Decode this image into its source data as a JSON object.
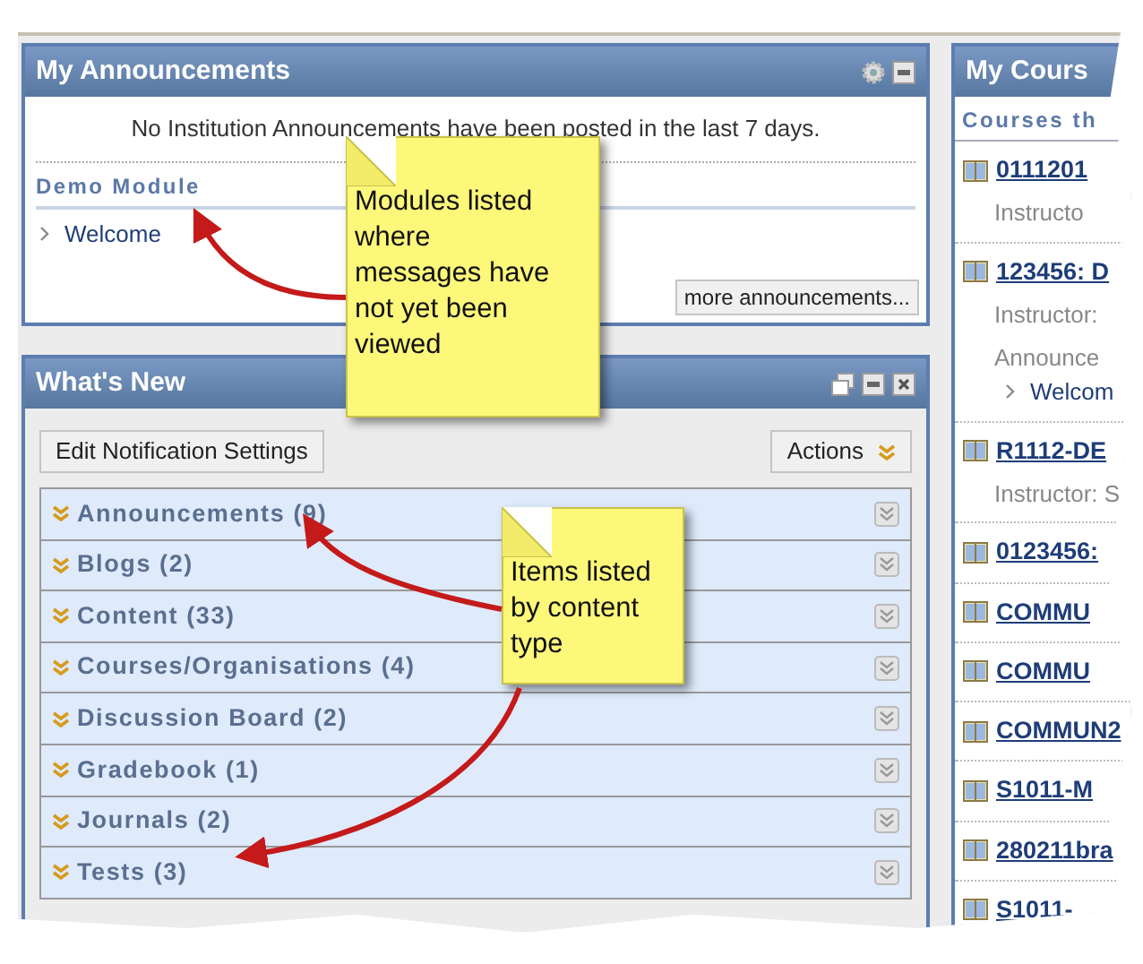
{
  "announcements": {
    "title": "My Announcements",
    "message": "No Institution Announcements have been posted in the last 7 days.",
    "module": "Demo Module",
    "items": [
      "Welcome"
    ],
    "more_button": "more announcements..."
  },
  "whats_new": {
    "title": "What's New",
    "edit_button": "Edit Notification Settings",
    "actions_button": "Actions",
    "categories": [
      {
        "label": "Announcements (9)"
      },
      {
        "label": "Blogs (2)"
      },
      {
        "label": "Content (33)"
      },
      {
        "label": "Courses/Organisations (4)"
      },
      {
        "label": "Discussion Board (2)"
      },
      {
        "label": "Gradebook (1)"
      },
      {
        "label": "Journals (2)"
      },
      {
        "label": "Tests (3)"
      }
    ]
  },
  "courses": {
    "title": "My Cours",
    "subtitle": "Courses th",
    "items": [
      {
        "link": "0111201",
        "lines": [
          "Instructo"
        ]
      },
      {
        "link": "123456: D",
        "lines": [
          "Instructor: ",
          "Announce"
        ],
        "sub_items": [
          "Welcom"
        ]
      },
      {
        "link": "R1112-DE",
        "lines": [
          "Instructor: S"
        ]
      },
      {
        "link": "0123456:"
      },
      {
        "link": "COMMU"
      },
      {
        "link": "COMMU"
      },
      {
        "link": "COMMUN2"
      },
      {
        "link": "S1011-M"
      },
      {
        "link": "280211bra"
      },
      {
        "link": "S1011-"
      }
    ]
  },
  "callouts": [
    {
      "text": "Modules listed where messages have not yet been viewed"
    },
    {
      "text": "Items listed by content type"
    }
  ]
}
